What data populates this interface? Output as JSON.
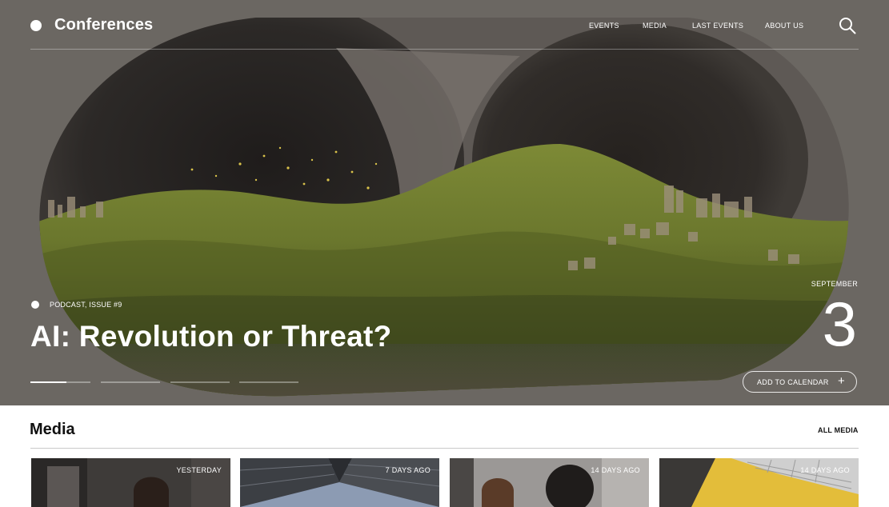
{
  "brand": {
    "name": "Conferences"
  },
  "nav": {
    "items": [
      "EVENTS",
      "MEDIA",
      "LAST EVENTS",
      "ABOUT US"
    ]
  },
  "hero": {
    "tag": "PODCAST, ISSUE #9",
    "headline": "AI: Revolution or Threat?",
    "month": "SEPTEMBER",
    "day": "3",
    "add_to_calendar": "ADD TO CALENDAR",
    "add_icon": "+",
    "slides_total": 4,
    "active_slide": 1,
    "active_slide_progress": 0.6
  },
  "media": {
    "title": "Media",
    "all_label": "ALL MEDIA",
    "cards": [
      {
        "time": "YESTERDAY"
      },
      {
        "time": "7 DAYS AGO"
      },
      {
        "time": "14 DAYS AGO"
      },
      {
        "time": "14 DAYS AGO"
      }
    ]
  },
  "icons": {
    "search": "search-icon",
    "logo": "dot-logo-icon"
  },
  "colors": {
    "hero_bg": "#6b6762",
    "grass": "#6f7b2e",
    "text_on_hero": "#ffffff",
    "card_accent_yellow": "#e3bd3a"
  }
}
